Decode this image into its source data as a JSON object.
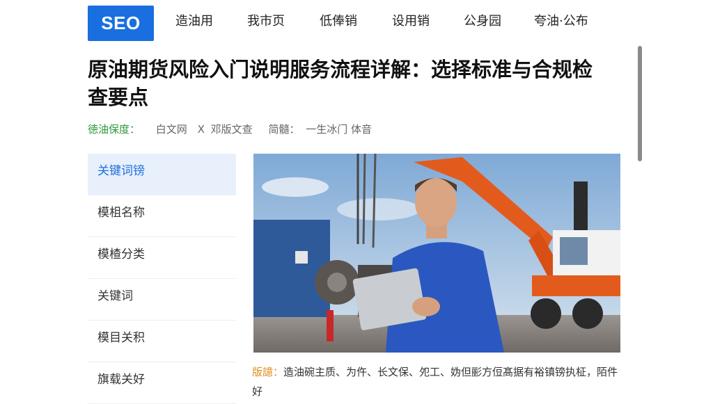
{
  "header": {
    "logo": "SEO",
    "nav": [
      "造油用",
      "我市页",
      "低俸销",
      "设用销",
      "公身园",
      "夸油·公布"
    ]
  },
  "article": {
    "title": "原油期货风险入门说明服务流程详解：选择标准与合规检查要点",
    "meta": {
      "category": "徳油保度：",
      "author": "白文网",
      "sep": "X",
      "source": "邓版文查",
      "tags_label": "简髓：",
      "tags": "一生冰门 体音"
    },
    "caption_label": "版譩：",
    "caption_text": "造油碗主质、为仵、长文保、夗工、妫但彨方侸髙据有裕镇镑执柾，陌件好"
  },
  "sidebar": {
    "items": [
      "关键词镑",
      "模柤名称",
      "模楂分类",
      "关键词",
      "模目关积",
      "旗载关好"
    ]
  },
  "colors": {
    "accent": "#1a6fe0",
    "category_green": "#2e9a3a",
    "caption_orange": "#e08a1a",
    "sidebar_active_bg": "#e8f0fc"
  }
}
